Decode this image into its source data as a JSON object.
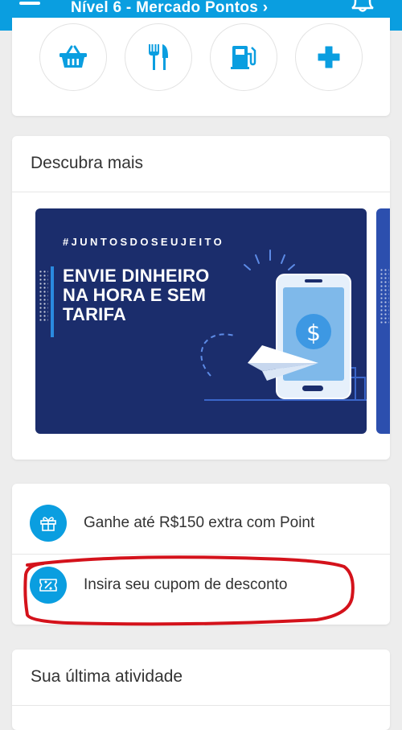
{
  "header": {
    "title": "Nível 6 - Mercado Pontos ›",
    "menu_icon": "hamburger-menu-icon",
    "bell_icon": "bell-icon",
    "background": "#0a9ee0"
  },
  "shortcuts": [
    {
      "icon": "basket-icon"
    },
    {
      "icon": "fork-knife-icon"
    },
    {
      "icon": "gas-pump-icon"
    },
    {
      "icon": "plus-cross-icon"
    }
  ],
  "discover": {
    "title": "Descubra mais",
    "banner": {
      "hashtag": "#JUNTOSDOSEUJEITO",
      "headline": "ENVIE DINHEIRO NA HORA E SEM TARIFA",
      "background": "#1b2d6c"
    }
  },
  "links": [
    {
      "label": "Ganhe até R$150 extra com Point",
      "icon": "gift-icon"
    },
    {
      "label": "Insira seu cupom de desconto",
      "icon": "coupon-icon"
    }
  ],
  "activity": {
    "title": "Sua última atividade"
  },
  "colors": {
    "accent": "#0a9ee0",
    "annotation": "#d4121b"
  }
}
